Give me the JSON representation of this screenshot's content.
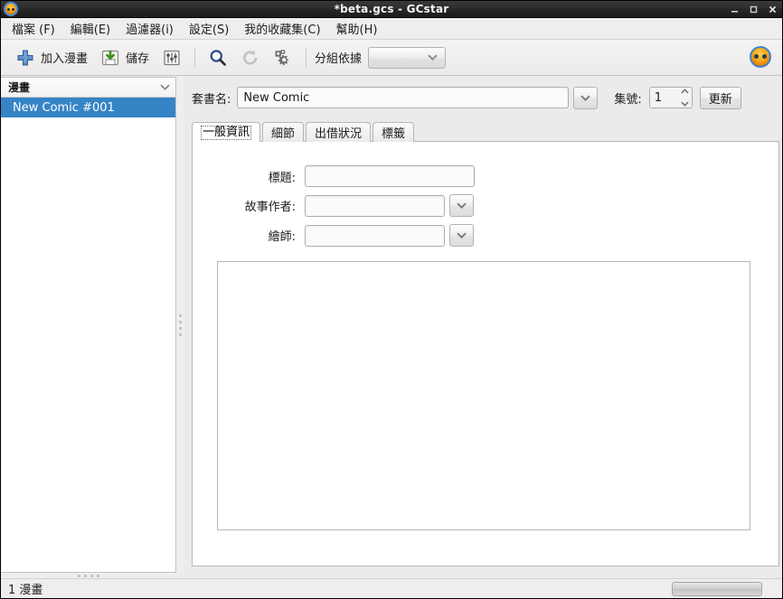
{
  "window": {
    "title": "*beta.gcs - GCstar",
    "icon": "gcstar-logo-icon",
    "buttons": {
      "minimize": "minimize-icon",
      "maximize": "maximize-icon",
      "close": "close-icon"
    }
  },
  "menubar": {
    "items": [
      {
        "label": "檔案 (F)",
        "name": "menu-file"
      },
      {
        "label": "編輯(E)",
        "name": "menu-edit"
      },
      {
        "label": "過濾器(i)",
        "name": "menu-filter"
      },
      {
        "label": "設定(S)",
        "name": "menu-settings"
      },
      {
        "label": "我的收藏集(C)",
        "name": "menu-collection"
      },
      {
        "label": "幫助(H)",
        "name": "menu-help"
      }
    ]
  },
  "toolbar": {
    "add_label": "加入漫畫",
    "save_label": "儲存",
    "fields_icon": "sliders-icon",
    "search_icon": "search-icon",
    "reload_icon": "reload-icon",
    "plugins_icon": "gears-icon",
    "groupby_label": "分組依據",
    "groupby_value": "",
    "logo_icon": "gcstar-logo-icon"
  },
  "sidebar": {
    "header": "漫畫",
    "sort_icon": "chevron-down-icon",
    "items": [
      {
        "label": "New Comic #001",
        "selected": true
      }
    ]
  },
  "main": {
    "series_label": "套書名:",
    "series_value": "New Comic",
    "series_dropdown_icon": "chevron-down-icon",
    "issue_label": "集號:",
    "issue_value": "1",
    "update_label": "更新",
    "tabs": [
      {
        "label": "一般資訊",
        "name": "tab-general",
        "active": true
      },
      {
        "label": "細節",
        "name": "tab-details",
        "active": false
      },
      {
        "label": "出借狀況",
        "name": "tab-lending",
        "active": false
      },
      {
        "label": "標籤",
        "name": "tab-tags",
        "active": false
      }
    ],
    "fields": [
      {
        "label": "標題:",
        "name": "title",
        "value": "",
        "dropdown": false
      },
      {
        "label": "故事作者:",
        "name": "writer",
        "value": "",
        "dropdown": true
      },
      {
        "label": "繪師:",
        "name": "artist",
        "value": "",
        "dropdown": true
      }
    ],
    "description_value": ""
  },
  "statusbar": {
    "text": "1 漫畫"
  },
  "colors": {
    "selection": "#3584c6",
    "titlebar": "#2b2b2b",
    "chrome": "#eceaea"
  }
}
